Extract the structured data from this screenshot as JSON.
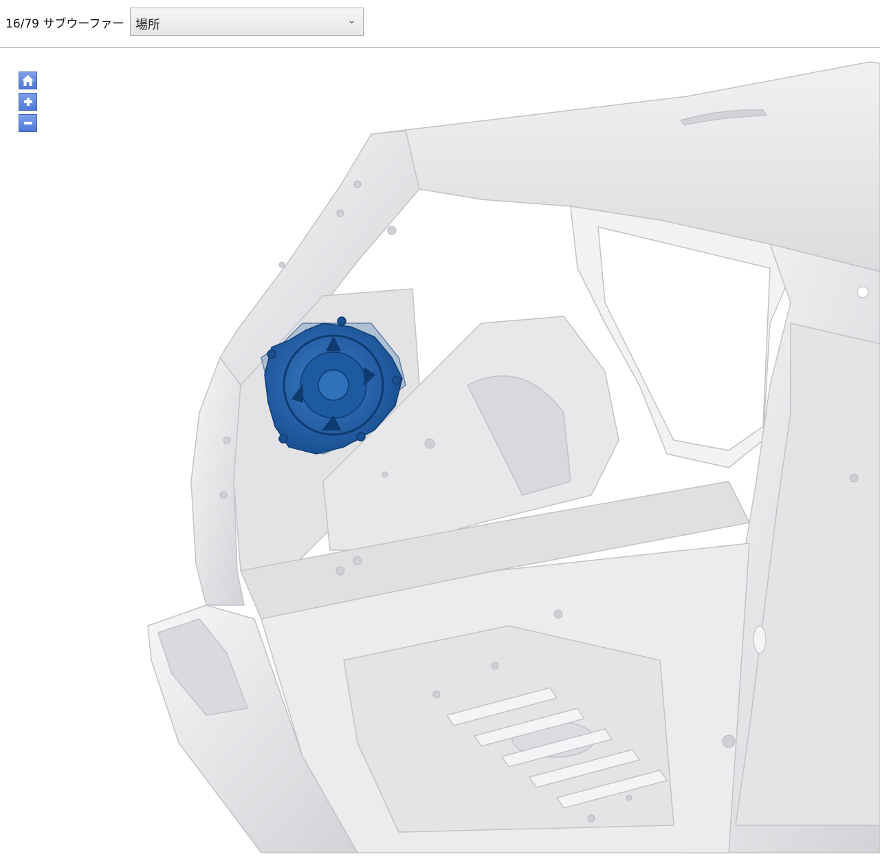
{
  "header": {
    "title": "16/79 サブウーファー",
    "location_select": {
      "value": "場所"
    }
  },
  "viewer": {
    "controls": [
      {
        "icon": "home-icon"
      },
      {
        "icon": "zoom-in-icon"
      },
      {
        "icon": "zoom-out-icon"
      }
    ],
    "highlight_color": "#1f5fa8",
    "body_color": "#e6e6e8"
  }
}
